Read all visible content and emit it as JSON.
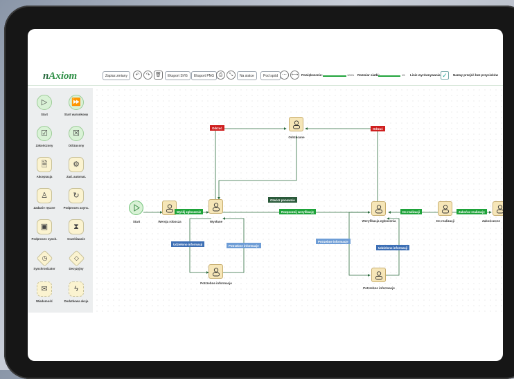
{
  "logo": {
    "prefix": "n",
    "name": "Axiom"
  },
  "toolbar": {
    "save": "Zapisz zmiany",
    "export_svg": "Eksport SVG",
    "export_png": "Eksport PNG",
    "grid_btn": "Na siatce",
    "bottom_btn": "Pod spód",
    "zoom_label": "Powiększenie:",
    "zoom_value": "100%",
    "grid_size_label": "Rozmiar siatki:",
    "grid_size_value": "15",
    "align_label": "Linie wyrównywania:",
    "hide_names_label": "Nazwy przejść bez przycisków"
  },
  "palette": [
    {
      "label": "Start",
      "icon": "play-icon",
      "glyph": "▷",
      "shape": "circ"
    },
    {
      "label": "Start warunkowy",
      "icon": "fast-forward-icon",
      "glyph": "⏩",
      "shape": "circ"
    },
    {
      "label": "Zakończony",
      "icon": "check-icon",
      "glyph": "☑",
      "shape": "circ"
    },
    {
      "label": "Odrzucony",
      "icon": "reject-icon",
      "glyph": "☒",
      "shape": "circ"
    },
    {
      "label": "Akceptacja",
      "icon": "document-icon",
      "glyph": "🗎",
      "shape": "sq"
    },
    {
      "label": "Zad. automat.",
      "icon": "gear-icon",
      "glyph": "⚙",
      "shape": "sq"
    },
    {
      "label": "Zadanie ręczne",
      "icon": "user-icon",
      "glyph": "♙",
      "shape": "sq"
    },
    {
      "label": "Podproces async.",
      "icon": "refresh-icon",
      "glyph": "↻",
      "shape": "sq"
    },
    {
      "label": "Podproces synch.",
      "icon": "subprocess-icon",
      "glyph": "▣",
      "shape": "sq"
    },
    {
      "label": "Oczekiwanie",
      "icon": "hourglass-icon",
      "glyph": "⧗",
      "shape": "sq"
    },
    {
      "label": "Synchronizator",
      "icon": "sync-icon",
      "glyph": "◷",
      "shape": "diam"
    },
    {
      "label": "Decyzyjny",
      "icon": "decision-icon",
      "glyph": "◇",
      "shape": "diam"
    },
    {
      "label": "Wiadomość",
      "icon": "mail-icon",
      "glyph": "✉",
      "shape": "dash"
    },
    {
      "label": "Dodatkowa akcja",
      "icon": "bolt-icon",
      "glyph": "ϟ",
      "shape": "dash"
    }
  ],
  "diagram": {
    "nodes": {
      "start": "Start",
      "draft": "Wersja robocza",
      "sent": "Wysłane",
      "rejecting": "Odrzucane",
      "info_needed_1": "Potrzebne informacje",
      "verification": "Weryfikacja zgłoszenia",
      "info_needed_2": "Potrzebne informacje",
      "to_realize": "Do realizacji",
      "completed": "Zakończone"
    },
    "edges": {
      "send": "Wyślij zgłoszenie",
      "reject1": "Odrzuć",
      "reject2": "Odrzuć",
      "reopen": "Otwórz ponownie",
      "provided1": "Udzielono informacji",
      "needed1": "Potrzebne informacje",
      "start_verify": "Rozpocznij weryfikację",
      "needed2": "Potrzebne informacje",
      "provided2": "Udzielono informacji",
      "to_realize": "Do realizacji",
      "finish": "Zakończ realizację"
    }
  },
  "colors": {
    "accent": "#1ea33a",
    "reject": "#cf1f1f",
    "info": "#3d6fb5",
    "node_fill": "#f6e6b8"
  }
}
